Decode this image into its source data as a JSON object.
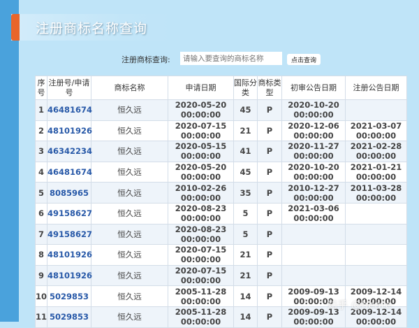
{
  "title": "注册商标名称查询",
  "search": {
    "label": "注册商标查询:",
    "placeholder": "请输入要查询的商标名称",
    "button": "点击查询"
  },
  "table": {
    "headers": [
      "序号",
      "注册号/申请号",
      "商标名称",
      "申请日期",
      "国际分类",
      "商标类型",
      "初审公告日期",
      "注册公告日期"
    ],
    "rows": [
      [
        "1",
        "46481674",
        "恒久远",
        "2020-05-20 00:00:00",
        "45",
        "P",
        "2020-10-20 00:00:00",
        ""
      ],
      [
        "2",
        "48101926",
        "恒久远",
        "2020-07-15 00:00:00",
        "21",
        "P",
        "2020-12-06 00:00:00",
        "2021-03-07 00:00:00"
      ],
      [
        "3",
        "46342234",
        "恒久远",
        "2020-05-15 00:00:00",
        "41",
        "P",
        "2020-11-27 00:00:00",
        "2021-02-28 00:00:00"
      ],
      [
        "4",
        "46481674",
        "恒久远",
        "2020-05-20 00:00:00",
        "45",
        "P",
        "2020-10-20 00:00:00",
        "2021-01-21 00:00:00"
      ],
      [
        "5",
        "8085965",
        "恒久远",
        "2010-02-26 00:00:00",
        "35",
        "P",
        "2010-12-27 00:00:00",
        "2011-03-28 00:00:00"
      ],
      [
        "6",
        "49158627",
        "恒久远",
        "2020-08-23 00:00:00",
        "5",
        "P",
        "2021-03-06 00:00:00",
        ""
      ],
      [
        "7",
        "49158627",
        "恒久远",
        "2020-08-23 00:00:00",
        "5",
        "P",
        "",
        ""
      ],
      [
        "8",
        "48101926",
        "恒久远",
        "2020-07-15 00:00:00",
        "21",
        "P",
        "",
        ""
      ],
      [
        "9",
        "48101926",
        "恒久远",
        "2020-07-15 00:00:00",
        "21",
        "P",
        "",
        ""
      ],
      [
        "10",
        "5029853",
        "恒久远",
        "2005-11-28 00:00:00",
        "14",
        "P",
        "2009-09-13 00:00:00",
        "2009-12-14 00:00:00"
      ],
      [
        "11",
        "5029853",
        "恒久远",
        "2005-11-28 00:00:00",
        "14",
        "P",
        "2009-09-13 00:00:00",
        "2009-12-14 00:00:00"
      ]
    ]
  },
  "watermark": "知乎 @heate"
}
